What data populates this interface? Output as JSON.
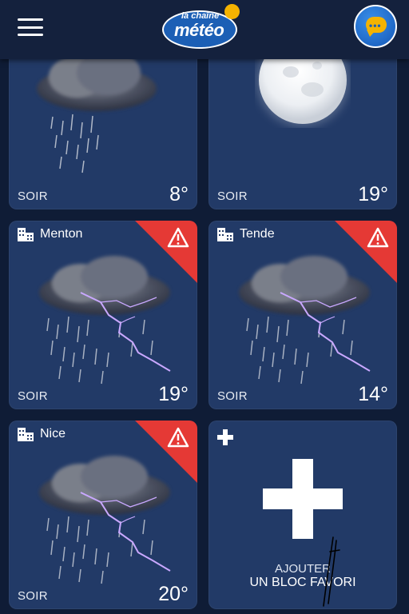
{
  "header": {
    "logo_top": "la chaîne",
    "logo_bottom": "météo"
  },
  "cards": [
    {
      "id": "c1",
      "city": "",
      "period": "SOIR",
      "temp": "8°",
      "weather": "rain",
      "alert": false
    },
    {
      "id": "c2",
      "city": "",
      "period": "SOIR",
      "temp": "19°",
      "weather": "clear-night",
      "alert": false
    },
    {
      "id": "c3",
      "city": "Menton",
      "period": "SOIR",
      "temp": "19°",
      "weather": "thunderstorm",
      "alert": true
    },
    {
      "id": "c4",
      "city": "Tende",
      "period": "SOIR",
      "temp": "14°",
      "weather": "thunderstorm",
      "alert": true
    },
    {
      "id": "c5",
      "city": "Nice",
      "period": "SOIR",
      "temp": "20°",
      "weather": "thunderstorm",
      "alert": true
    }
  ],
  "add_card": {
    "line1": "AJOUTER",
    "line2": "UN BLOC FAVORI"
  },
  "colors": {
    "background": "#0f1c36",
    "header": "#14213d",
    "card": "#223a67",
    "alert": "#e53935",
    "logo_sun": "#f5b301",
    "logo_blue": "#1c5fb5"
  }
}
